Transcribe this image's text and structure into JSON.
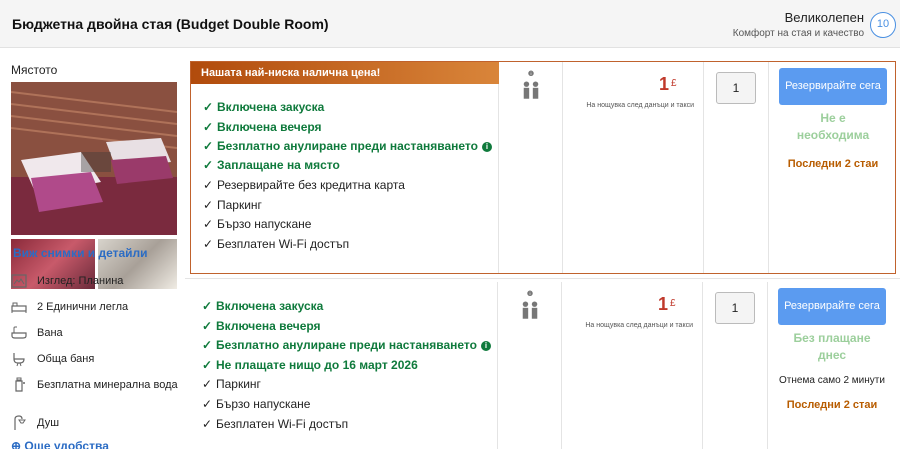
{
  "header": {
    "room_title": "Бюджетна двойна стая (Budget Double Room)",
    "rating_word": "Великолепен",
    "rating_sub": "Комфорт на стая и качество",
    "rating_score": "10"
  },
  "left": {
    "place_label": "Мястото",
    "view_link": "Виж снимки и детайли",
    "amenities": [
      {
        "label": "Изглед: Планина",
        "icon": "mountain-view-icon"
      },
      {
        "label": "2 Единични легла",
        "icon": "single-bed-icon"
      },
      {
        "label": "Вана",
        "icon": "bathtub-icon"
      },
      {
        "label": "Обща баня",
        "icon": "shared-bathroom-icon"
      },
      {
        "label": "Безплатна минерална вода",
        "icon": "water-bottle-icon"
      },
      {
        "label": "Душ",
        "icon": "shower-icon"
      }
    ],
    "more_link": "Още удобства"
  },
  "offer1": {
    "banner": "Нашата най-ниска налична цена!",
    "conditions": [
      {
        "text": "Включена закуска",
        "green": true,
        "info": false
      },
      {
        "text": "Включена вечеря",
        "green": true,
        "info": false
      },
      {
        "text": "Безплатно анулиране преди настаняването",
        "green": true,
        "info": true
      },
      {
        "text": "Заплащане на място",
        "green": true,
        "info": false
      },
      {
        "text": "Резервирайте без кредитна карта",
        "green": false,
        "info": false
      },
      {
        "text": "Паркинг",
        "green": false,
        "info": false
      },
      {
        "text": "Бързо напускане",
        "green": false,
        "info": false
      },
      {
        "text": "Безплатен Wi-Fi достъп",
        "green": false,
        "info": false
      }
    ],
    "price": "1",
    "currency": "£",
    "price_note": "На нощувка след данъци и такси",
    "qty": "1",
    "book_label": "Резервирайте сега",
    "prepay_line1": "Не е",
    "prepay_line2": "необходима",
    "last_rooms": "Последни 2 стаи"
  },
  "offer2": {
    "conditions": [
      {
        "text": "Включена закуска",
        "green": true,
        "info": false
      },
      {
        "text": "Включена вечеря",
        "green": true,
        "info": false
      },
      {
        "text": "Безплатно анулиране преди настаняването",
        "green": true,
        "info": true
      },
      {
        "text": "Не плащате нищо до 16 март 2026",
        "green": true,
        "info": false
      },
      {
        "text": "Паркинг",
        "green": false,
        "info": false
      },
      {
        "text": "Бързо напускане",
        "green": false,
        "info": false
      },
      {
        "text": "Безплатен Wi-Fi достъп",
        "green": false,
        "info": false
      }
    ],
    "price": "1",
    "currency": "£",
    "price_note": "На нощувка след данъци и такси",
    "qty": "1",
    "book_label": "Резервирайте сега",
    "pay_line1": "Без плащане",
    "pay_line2": "днес",
    "only_until": "Отнема само 2 минути",
    "last_rooms": "Последни 2 стаи"
  },
  "colors": {
    "accent_blue": "#5b9bf0",
    "green": "#0f7a3c",
    "price_red": "#c0392b",
    "banner_orange": "#b14b0c",
    "last_rooms": "#b85c00"
  }
}
